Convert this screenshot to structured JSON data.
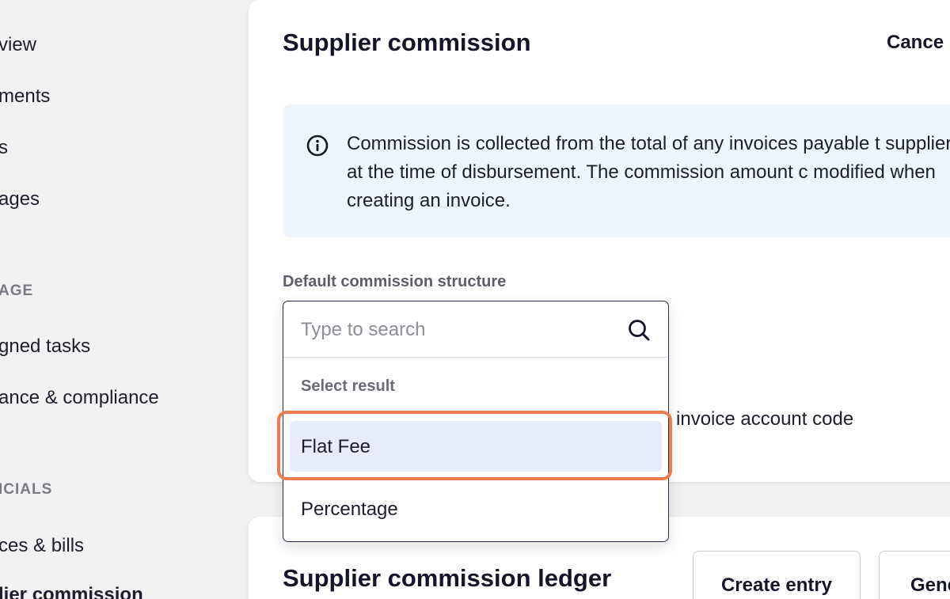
{
  "sidebar": {
    "items": [
      {
        "label": "view"
      },
      {
        "label": "ments"
      },
      {
        "label": "s"
      },
      {
        "label": "ages"
      },
      {
        "label": "gned tasks"
      },
      {
        "label": "ance & compliance"
      },
      {
        "label": "ces & bills"
      },
      {
        "label": "lier commission"
      }
    ],
    "sections": [
      {
        "label": "AGE"
      },
      {
        "label": "ICIALS"
      }
    ]
  },
  "panel": {
    "title": "Supplier commission",
    "cancel_label": "Cance",
    "info_text": "Commission is collected from the total of any invoices payable t supplier at the time of disbursement. The commission amount c modified when creating an invoice.",
    "field_label": "Default commission structure",
    "behind_text": "n invoice account code"
  },
  "dropdown": {
    "search_placeholder": "Type to search",
    "search_value": "",
    "group_label": "Select result",
    "options": [
      {
        "label": "Flat Fee",
        "highlighted": true
      },
      {
        "label": "Percentage",
        "highlighted": false
      }
    ]
  },
  "ledger": {
    "title": "Supplier commission ledger",
    "create_button": "Create entry",
    "generate_button": "Gene"
  },
  "colors": {
    "accent_highlight": "#ef7c4e",
    "info_bg": "#eef5fc",
    "option_active_bg": "#e8ecfa"
  }
}
